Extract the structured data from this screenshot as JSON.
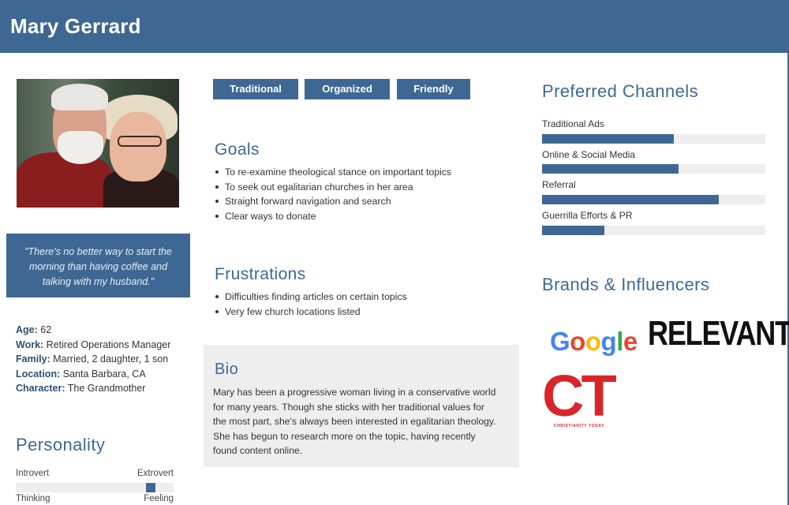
{
  "header": {
    "title": "Mary Gerrard"
  },
  "quote": "\"There's no better way to start the morning than having coffee and talking with my husband.\"",
  "facts": [
    {
      "label": "Age:",
      "value": "62"
    },
    {
      "label": "Work:",
      "value": "Retired Operations Manager"
    },
    {
      "label": "Family:",
      "value": "Married, 2 daughter, 1 son"
    },
    {
      "label": "Location:",
      "value": "Santa Barbara, CA"
    },
    {
      "label": "Character:",
      "value": "The Grandmother"
    }
  ],
  "personality": {
    "title": "Personality",
    "scales": [
      {
        "left": "Introvert",
        "right": "Extrovert",
        "level": 0.88
      },
      {
        "left": "Thinking",
        "right": "Feeling"
      }
    ]
  },
  "tags": [
    "Traditional",
    "Organized",
    "Friendly"
  ],
  "goals": {
    "title": "Goals",
    "items": [
      "To re-examine theological stance on important topics",
      "To seek out egalitarian churches in her area",
      "Straight forward navigation and search",
      "Clear ways to donate"
    ]
  },
  "frustrations": {
    "title": "Frustrations",
    "items": [
      "Difficulties finding articles on certain topics",
      "Very few church locations listed"
    ]
  },
  "bio": {
    "title": "Bio",
    "text": "Mary has been a progressive woman living in a conservative world for many years. Though she sticks with her traditional values for the most part, she's always been interested in egalitarian theology. She has begun to research more on the topic, having recently found content online."
  },
  "channels": {
    "title": "Preferred Channels",
    "items": [
      {
        "label": "Traditional Ads",
        "level": 0.59
      },
      {
        "label": "Online & Social Media",
        "level": 0.61
      },
      {
        "label": "Referral",
        "level": 0.79
      },
      {
        "label": "Guerrilla Efforts & PR",
        "level": 0.28
      }
    ]
  },
  "brands": {
    "title": "Brands & Influencers",
    "google": "Google",
    "relevant": "RELEVANT",
    "ct_letters": "CT",
    "ct_sub": "CHRISTIANITY TODAY"
  },
  "colors": {
    "accent": "#3e6893",
    "track": "#eeeeee"
  }
}
